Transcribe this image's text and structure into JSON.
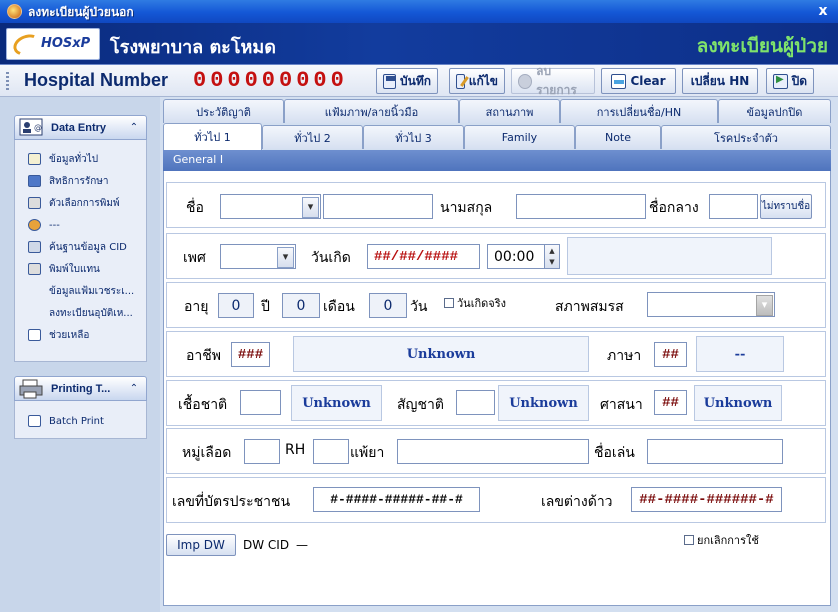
{
  "window": {
    "title": "ลงทะเบียนผู้ป่วยนอก",
    "close_label": "x"
  },
  "banner": {
    "logo_text": "HOSxP",
    "hospital_name": "โรงพยาบาล ตะโหมด",
    "module_title": "ลงทะเบียนผู้ป่วย"
  },
  "toolbar": {
    "hn_label": "Hospital Number",
    "hn_value": "000000000",
    "save": "บันทึก",
    "edit": "แก้ไข",
    "delete": "ลบรายการ",
    "clear": "Clear",
    "change_hn": "เปลี่ยน HN",
    "close": "ปิด"
  },
  "sidebar": {
    "data_entry": {
      "title": "Data Entry",
      "items": [
        "ข้อมูลทั่วไป",
        "สิทธิการรักษา",
        "ตัวเลือกการพิมพ์",
        "---",
        "ค้นฐานข้อมูล CID",
        "พิมพ์ใบแทน",
        "ข้อมูลแฟ้มเวชระเ...",
        "ลงทะเบียนอุบัติเห...",
        "ช่วยเหลือ"
      ]
    },
    "printing": {
      "title": "Printing T...",
      "items": [
        "Batch Print"
      ]
    }
  },
  "tabs": {
    "top": [
      "ประวัติญาติ",
      "แฟ้มภาพ/ลายนิ้วมือ",
      "สถานภาพ",
      "การเปลี่ยนชื่อ/HN",
      "ข้อมูลปกปิด"
    ],
    "bottom": [
      "ทั่วไป 1",
      "ทั่วไป 2",
      "ทั่วไป 3",
      "Family",
      "Note",
      "โรคประจำตัว"
    ]
  },
  "form": {
    "group_title": "General I",
    "name_label": "ชื่อ",
    "surname_label": "นามสกุล",
    "middle_name_label": "ชื่อกลาง",
    "unknown_name_btn": "ไม่ทราบชื่อ",
    "sex_label": "เพศ",
    "birthdate_label": "วันเกิด",
    "birthdate_value": "##/##/####",
    "birthtime_value": "00:00",
    "age_label": "อายุ",
    "age_years": "0",
    "years_label": "ปี",
    "age_months": "0",
    "months_label": "เดือน",
    "age_days": "0",
    "days_label": "วัน",
    "real_birthdate_chk": "วันเกิดจริง",
    "marital_label": "สภาพสมรส",
    "occupation_label": "อาชีพ",
    "occupation_code": "###",
    "occupation_name": "Unknown",
    "language_label": "ภาษา",
    "language_code": "##",
    "language_name": "--",
    "race_label": "เชื้อชาติ",
    "race_name": "Unknown",
    "nationality_label": "สัญชาติ",
    "nationality_name": "Unknown",
    "religion_label": "ศาสนา",
    "religion_code": "##",
    "religion_name": "Unknown",
    "bloodgroup_label": "หมู่เลือด",
    "rh_label": "RH",
    "allergy_label": "แพ้ยา",
    "nickname_label": "ชื่อเล่น",
    "cid_label": "เลขที่บัตรประชาชน",
    "cid_value": "#-####-#####-##-#",
    "alien_label": "เลขต่างด้าว",
    "alien_value": "##-####-######-#",
    "imp_dw_btn": "Imp DW",
    "dw_cid_label": "DW CID",
    "dw_cid_value": "—",
    "cancel_use_chk": "ยกเลิกการใช้"
  }
}
